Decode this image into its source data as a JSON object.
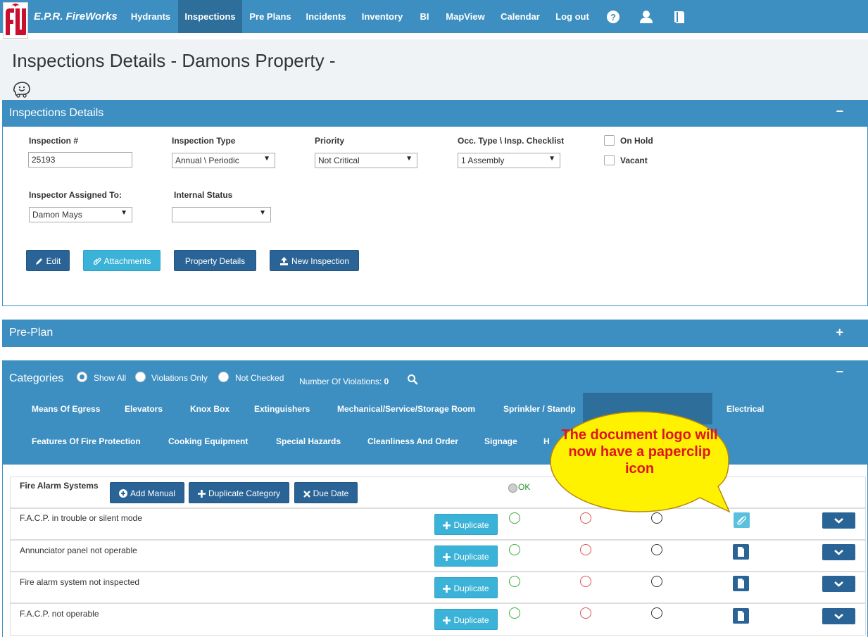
{
  "app": {
    "brand": "E.P.R. FireWorks",
    "nav": [
      {
        "label": "Hydrants"
      },
      {
        "label": "Inspections"
      },
      {
        "label": "Pre Plans"
      },
      {
        "label": "Incidents"
      },
      {
        "label": "Inventory"
      },
      {
        "label": "BI"
      },
      {
        "label": "MapView"
      },
      {
        "label": "Calendar"
      },
      {
        "label": "Log out"
      }
    ],
    "nav_icons": [
      "help-icon",
      "user-icon",
      "book-icon"
    ],
    "active_nav": "Inspections",
    "colors": {
      "primary": "#3e8fc1",
      "button_dark": "#2a6496",
      "button_light": "#3bb2d7",
      "callout_fill": "#fff200",
      "callout_text": "#e0141e"
    }
  },
  "page": {
    "title": "Inspections Details - Damons Property -"
  },
  "details_panel": {
    "title": "Inspections Details",
    "toggle": "−",
    "fields": {
      "inspection_no": {
        "label": "Inspection #",
        "value": "25193"
      },
      "inspection_type": {
        "label": "Inspection Type",
        "value": "Annual \\ Periodic"
      },
      "priority": {
        "label": "Priority",
        "value": "Not Critical"
      },
      "occ_type": {
        "label": "Occ. Type \\ Insp. Checklist",
        "value": "1 Assembly"
      },
      "on_hold": {
        "label": "On Hold",
        "checked": false
      },
      "vacant": {
        "label": "Vacant",
        "checked": false
      },
      "inspector": {
        "label": "Inspector Assigned To:",
        "value": "Damon Mays"
      },
      "internal_status": {
        "label": "Internal Status",
        "value": ""
      }
    },
    "buttons": {
      "edit": "Edit",
      "attachments": "Attachments",
      "property_details": "Property Details",
      "new_inspection": "New Inspection"
    }
  },
  "preplan_panel": {
    "title": "Pre-Plan",
    "toggle": "+"
  },
  "categories_panel": {
    "title": "Categories",
    "toggle": "−",
    "filters": [
      {
        "label": "Show All",
        "selected": true
      },
      {
        "label": "Violations Only",
        "selected": false
      },
      {
        "label": "Not Checked",
        "selected": false
      }
    ],
    "violations_label": "Number Of Violations:",
    "violations_count": "0",
    "row1": [
      "Means Of Egress",
      "Elevators",
      "Knox Box",
      "Extinguishers",
      "Mechanical/Service/Storage Room",
      "Sprinkler / Standp",
      "Electrical"
    ],
    "row2": [
      "Features Of Fire Protection",
      "Cooking Equipment",
      "Special Hazards",
      "Cleanliness And Order",
      "Signage",
      "H"
    ]
  },
  "section": {
    "title": "Fire Alarm Systems",
    "buttons": {
      "add_manual": "Add Manual",
      "duplicate_category": "Duplicate Category",
      "due_date": "Due Date"
    },
    "ok_label": "OK"
  },
  "items": [
    {
      "label": "F.A.C.P. in trouble or silent mode",
      "duplicate": "Duplicate",
      "doc_icon": "paperclip-icon"
    },
    {
      "label": "Annunciator panel not operable",
      "duplicate": "Duplicate",
      "doc_icon": "document-icon"
    },
    {
      "label": "Fire alarm system not inspected",
      "duplicate": "Duplicate",
      "doc_icon": "document-icon"
    },
    {
      "label": "F.A.C.P. not operable",
      "duplicate": "Duplicate",
      "doc_icon": "document-icon"
    }
  ],
  "callout": {
    "text": "The document logo will now have a paperclip icon"
  }
}
